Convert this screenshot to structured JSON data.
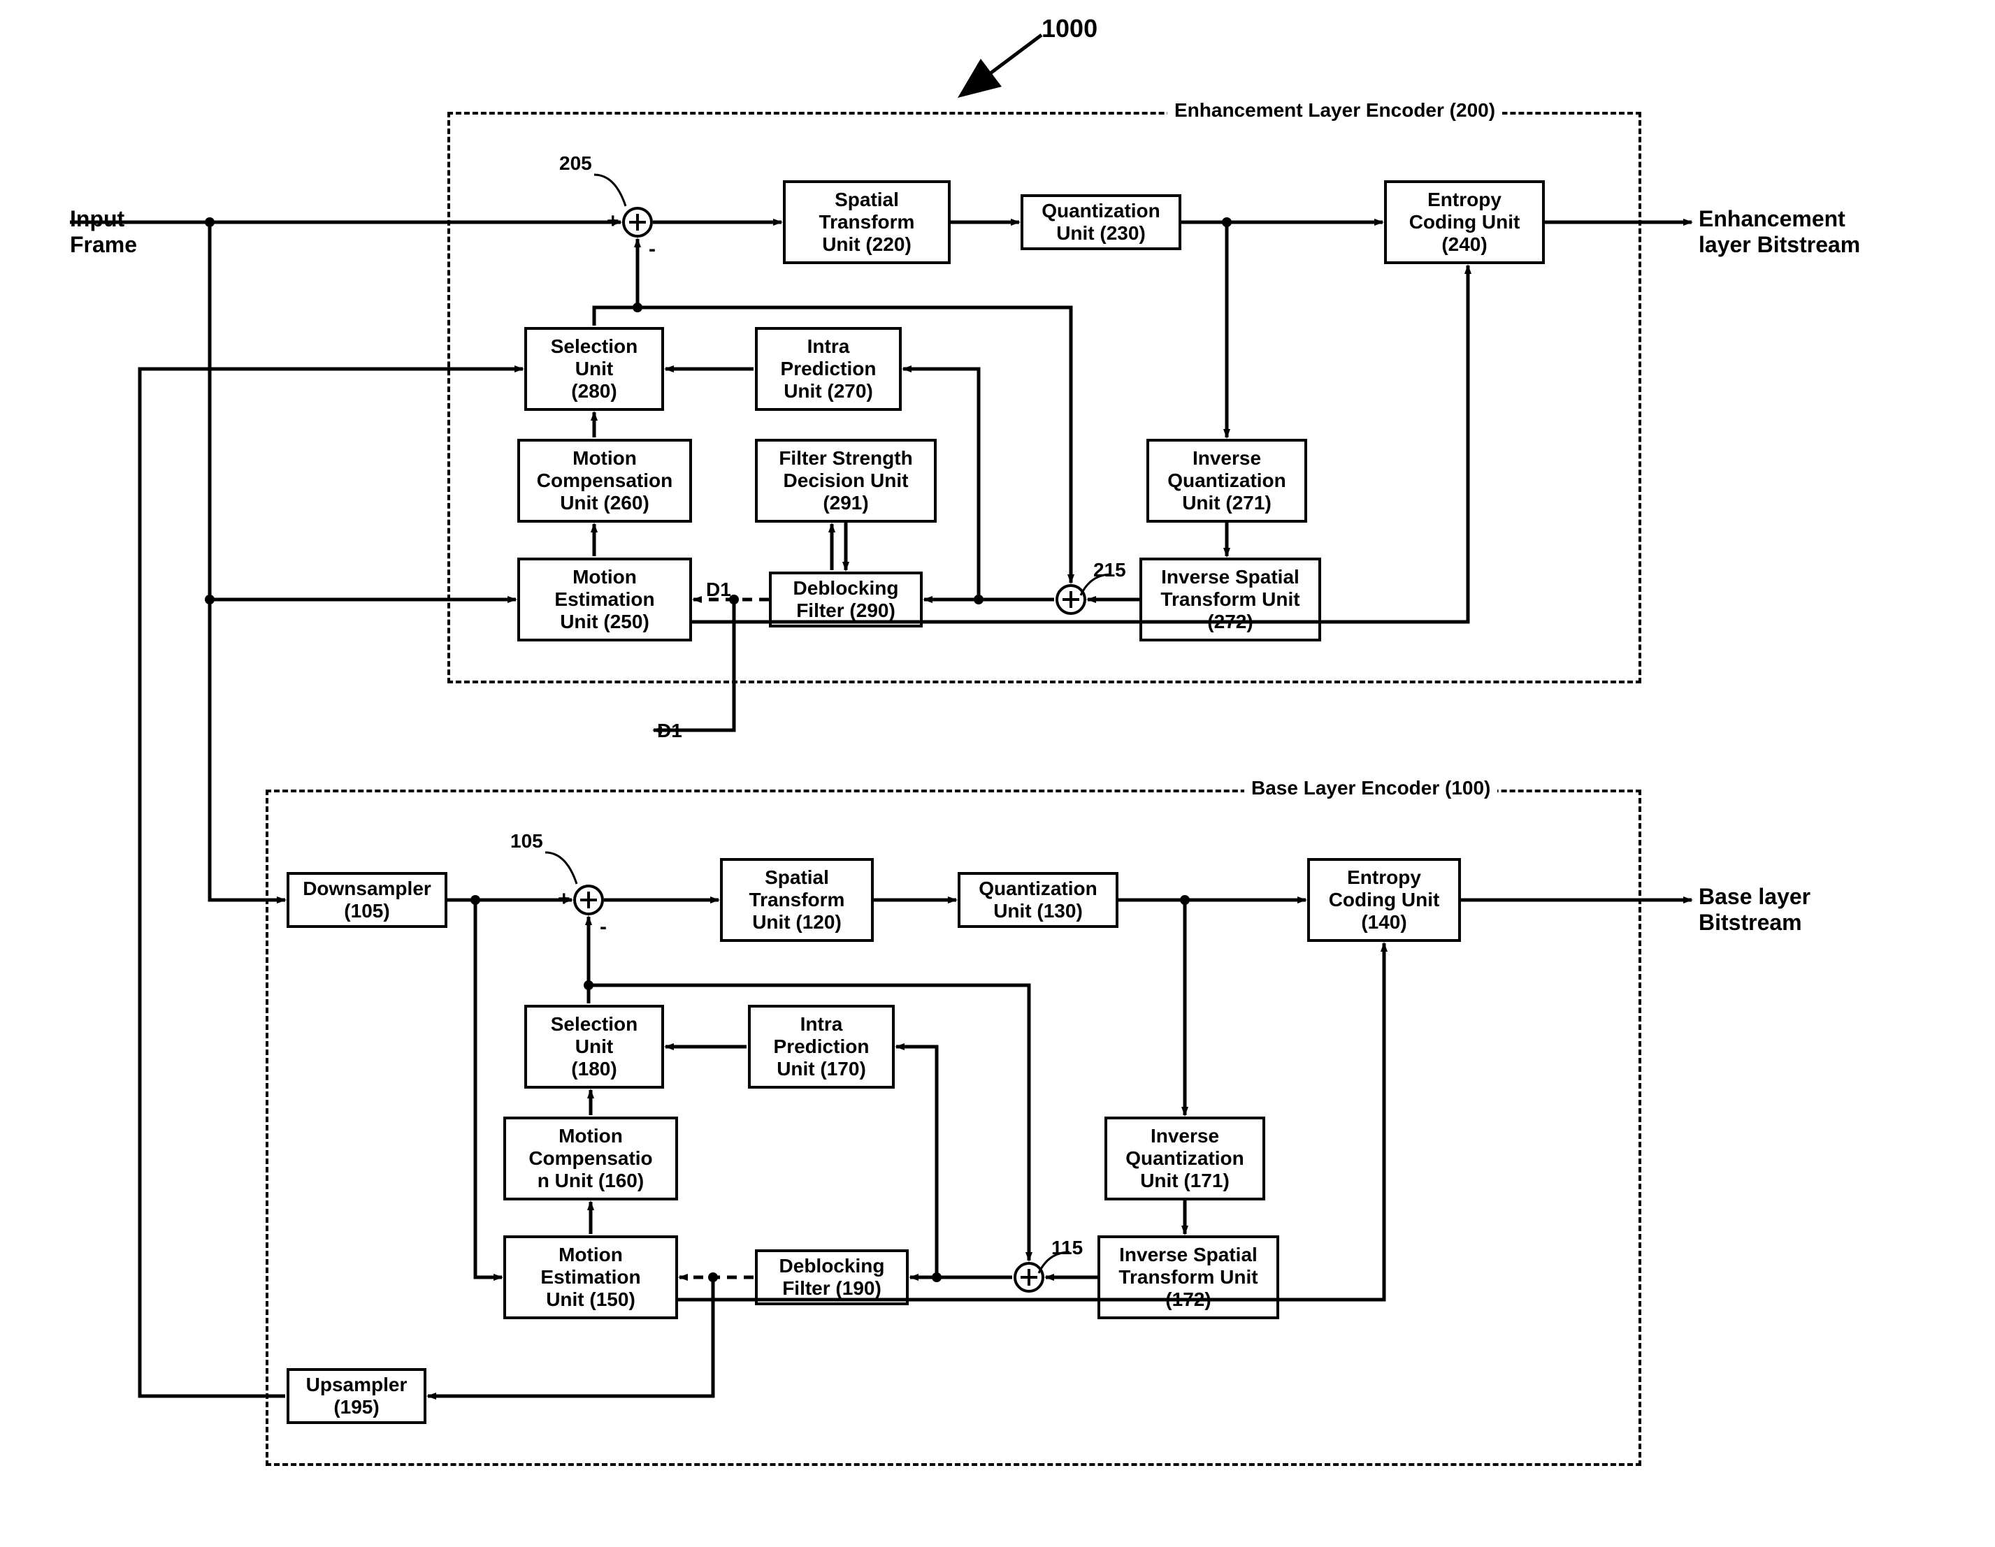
{
  "figure_ref": "1000",
  "input_label": "Input\nFrame",
  "d1_tap": "D1",
  "d1_out": "D1",
  "enhancement": {
    "title": "Enhancement Layer Encoder (200)",
    "output_label": "Enhancement\nlayer Bitstream",
    "sum205": "205",
    "sum215": "215",
    "blocks": {
      "spatial_transform": "Spatial\nTransform\nUnit (220)",
      "quantization": "Quantization\nUnit (230)",
      "entropy": "Entropy\nCoding Unit\n(240)",
      "selection": "Selection\nUnit\n(280)",
      "intra_pred": "Intra\nPrediction\nUnit (270)",
      "motion_comp": "Motion\nCompensation\nUnit (260)",
      "filter_strength": "Filter Strength\nDecision Unit\n(291)",
      "inv_quant": "Inverse\nQuantization\nUnit (271)",
      "motion_est": "Motion\nEstimation\nUnit (250)",
      "deblocking": "Deblocking\nFilter (290)",
      "inv_spatial": "Inverse Spatial\nTransform Unit\n(272)"
    }
  },
  "base": {
    "title": "Base Layer Encoder (100)",
    "output_label": "Base layer\nBitstream",
    "sum105": "105",
    "sum115": "115",
    "blocks": {
      "downsampler": "Downsampler\n(105)",
      "spatial_transform": "Spatial\nTransform\nUnit (120)",
      "quantization": "Quantization\nUnit (130)",
      "entropy": "Entropy\nCoding Unit\n(140)",
      "selection": "Selection\nUnit\n(180)",
      "intra_pred": "Intra\nPrediction\nUnit (170)",
      "motion_comp": "Motion\nCompensatio\nn Unit (160)",
      "inv_quant": "Inverse\nQuantization\nUnit (171)",
      "motion_est": "Motion\nEstimation\nUnit (150)",
      "deblocking": "Deblocking\nFilter (190)",
      "inv_spatial": "Inverse Spatial\nTransform Unit\n(172)",
      "upsampler": "Upsampler\n(195)"
    }
  }
}
